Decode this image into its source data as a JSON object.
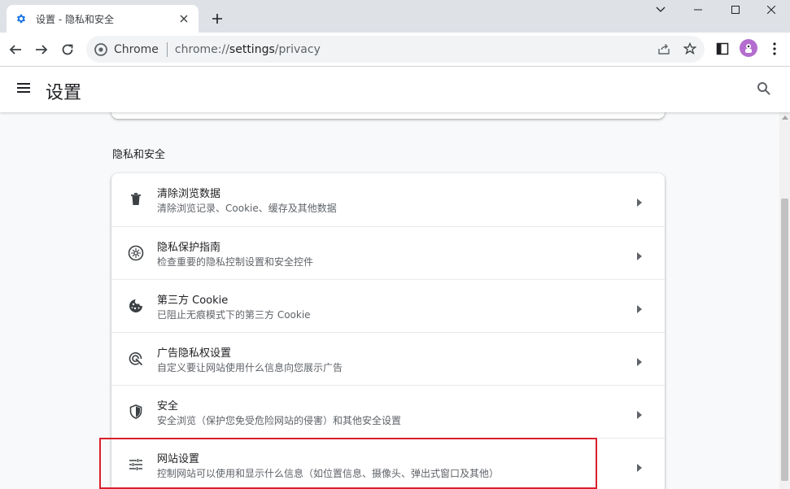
{
  "browser": {
    "tab_title": "设置 - 隐私和安全",
    "new_tab_label": "+",
    "omnibox": {
      "chip_label": "Chrome",
      "url_scheme": "chrome://",
      "url_host": "settings",
      "url_path": "/privacy"
    }
  },
  "header": {
    "title": "设置"
  },
  "privacy": {
    "section_title": "隐私和安全",
    "items": [
      {
        "label": "清除浏览数据",
        "sub": "清除浏览记录、Cookie、缓存及其他数据",
        "icon": "trash-icon"
      },
      {
        "label": "隐私保护指南",
        "sub": "检查重要的隐私控制设置和安全控件",
        "icon": "compass-icon"
      },
      {
        "label": "第三方 Cookie",
        "sub": "已阻止无痕模式下的第三方 Cookie",
        "icon": "cookie-icon"
      },
      {
        "label": "广告隐私权设置",
        "sub": "自定义要让网站使用什么信息向您展示广告",
        "icon": "ad-privacy-icon"
      },
      {
        "label": "安全",
        "sub": "安全浏览（保护您免受危险网站的侵害）和其他安全设置",
        "icon": "shield-icon"
      },
      {
        "label": "网站设置",
        "sub": "控制网站可以使用和显示什么信息（如位置信息、摄像头、弹出式窗口及其他）",
        "icon": "tune-icon"
      }
    ]
  },
  "colors": {
    "accent_blue": "#1a73e8",
    "highlight_red": "#d9202a",
    "avatar_purple": "#b46dcf"
  }
}
